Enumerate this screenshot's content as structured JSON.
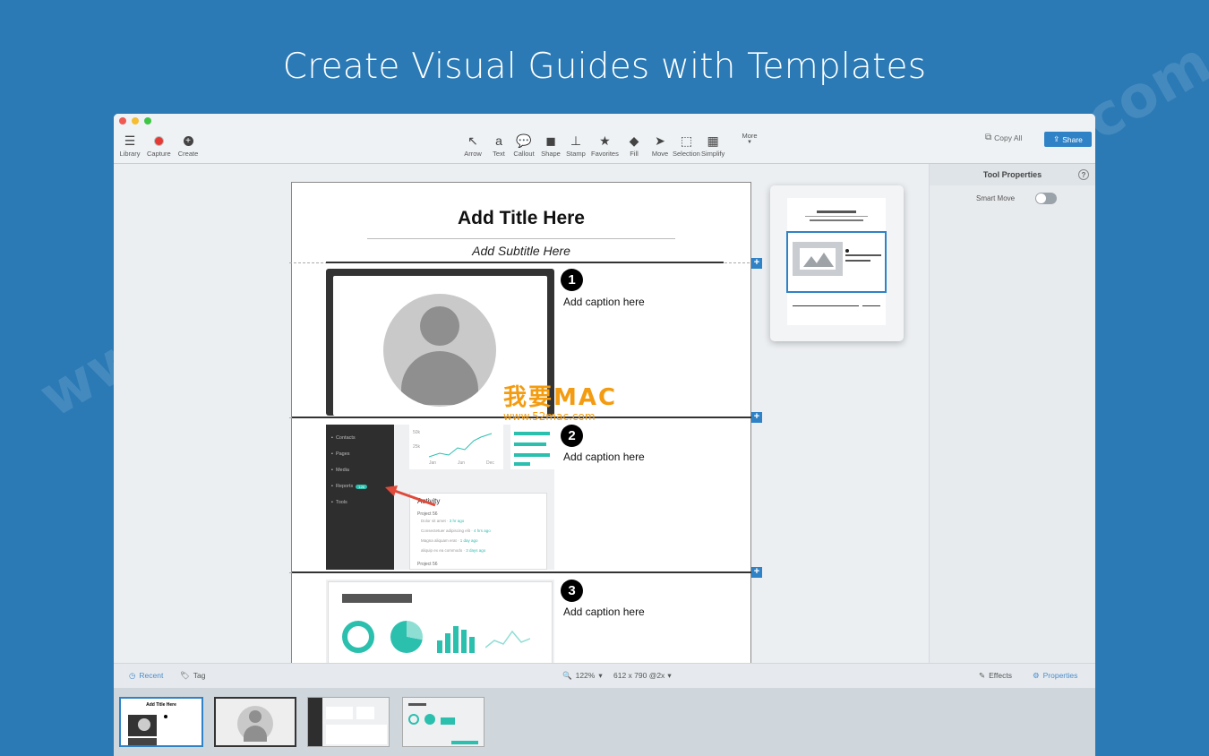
{
  "headline": "Create Visual Guides with Templates",
  "watermark": "www.52mac.com",
  "brand": {
    "title": "我要MAC",
    "url": "www.52mac.com"
  },
  "toolbar": {
    "left": [
      {
        "label": "Library",
        "icon": "list-icon"
      },
      {
        "label": "Capture",
        "icon": "record-icon"
      },
      {
        "label": "Create",
        "icon": "plus-circle-icon"
      }
    ],
    "tools": [
      {
        "label": "Arrow",
        "glyph": "↖"
      },
      {
        "label": "Text",
        "glyph": "a"
      },
      {
        "label": "Callout",
        "glyph": "💬"
      },
      {
        "label": "Shape",
        "glyph": "◼"
      },
      {
        "label": "Stamp",
        "glyph": "⊥"
      },
      {
        "label": "Favorites",
        "glyph": "★"
      },
      {
        "label": "Fill",
        "glyph": "◆"
      },
      {
        "label": "Move",
        "glyph": "➤"
      },
      {
        "label": "Selection",
        "glyph": "⬚"
      },
      {
        "label": "Simplify",
        "glyph": "▦"
      }
    ],
    "more": "More",
    "copy_all": "Copy All",
    "share": "Share"
  },
  "document": {
    "title": "Add Title Here",
    "subtitle": "Add Subtitle Here",
    "steps": [
      {
        "number": "1",
        "caption": "Add caption here"
      },
      {
        "number": "2",
        "caption": "Add caption here"
      },
      {
        "number": "3",
        "caption": "Add caption here"
      }
    ],
    "screenshot2": {
      "sidebar": [
        "Contacts",
        "Pages",
        "Media",
        "Reports",
        "Tools"
      ],
      "badge": "126",
      "chart_ticks_y": [
        "50k",
        "25k"
      ],
      "chart_ticks_x": [
        "Jan",
        "Jun",
        "Dec"
      ],
      "activity_title": "Activity",
      "project_label": "Project 56",
      "activity_items": [
        {
          "text": "Dolor sit amet",
          "time": "3 hr ago"
        },
        {
          "text": "Consectetuer adipiscing elit",
          "time": "4 hrs ago"
        },
        {
          "text": "Magna aliquam erat",
          "time": "1 day ago"
        },
        {
          "text": "aliquip ex ea commodo",
          "time": "3 days ago"
        }
      ],
      "project_label_2": "Project 56"
    }
  },
  "properties": {
    "title": "Tool Properties",
    "help": "?",
    "smart_move_label": "Smart Move",
    "smart_move_on": false
  },
  "status": {
    "recent": "Recent",
    "tag": "Tag",
    "zoom": "122%",
    "size": "612 x 790 @2x",
    "effects": "Effects",
    "properties": "Properties"
  },
  "colors": {
    "background": "#2b7ab5",
    "accent": "#2f82c6",
    "teal": "#2bbfae"
  }
}
